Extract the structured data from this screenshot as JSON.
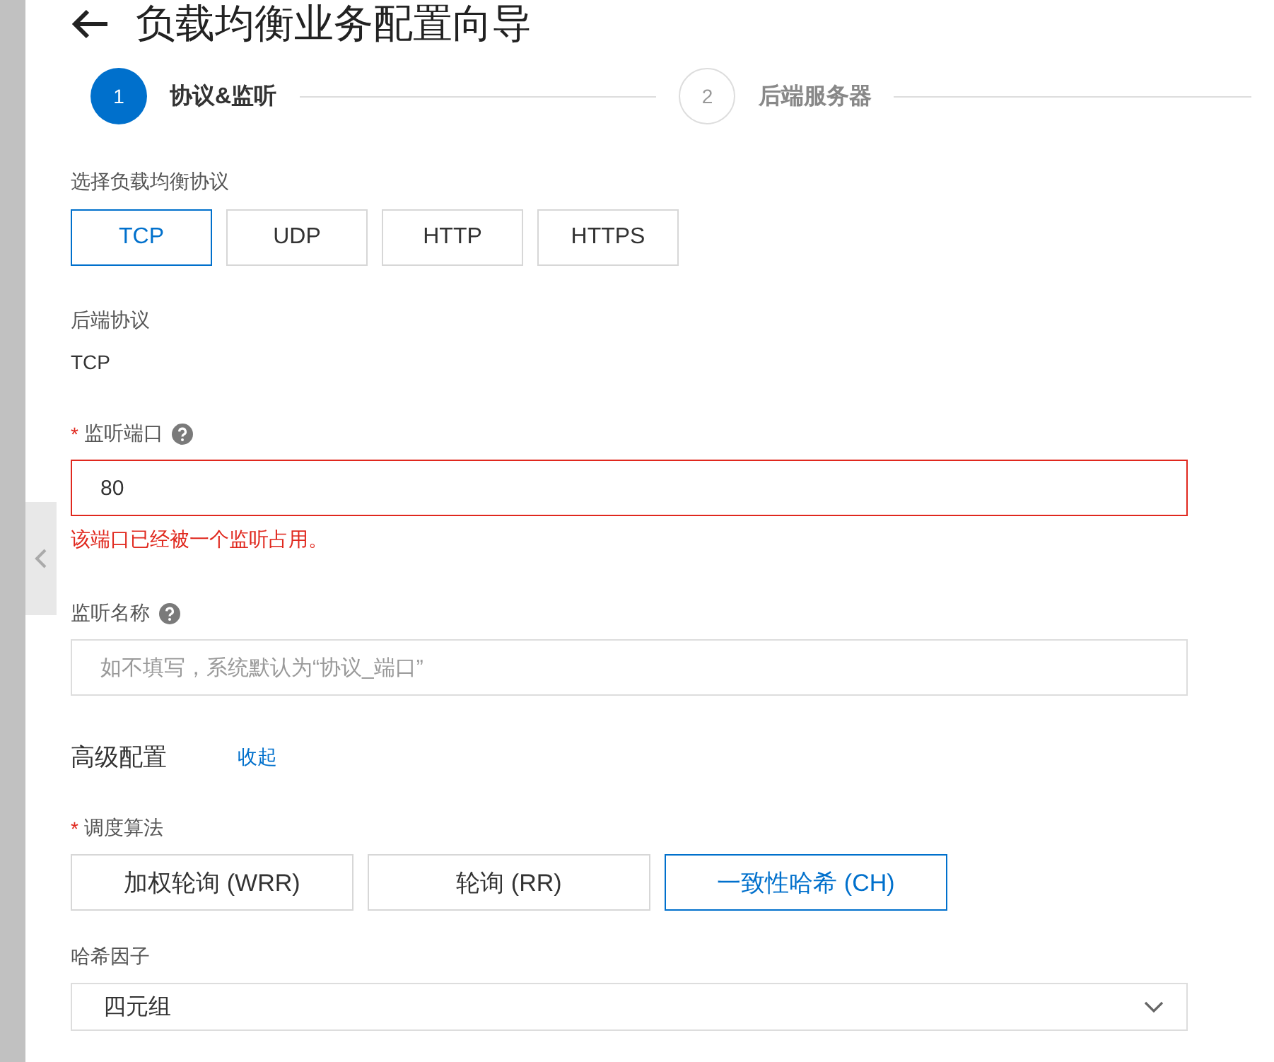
{
  "title": "负载均衡业务配置向导",
  "steps": [
    {
      "number": "1",
      "label": "协议&监听",
      "selected": true
    },
    {
      "number": "2",
      "label": "后端服务器",
      "selected": false
    }
  ],
  "protocol": {
    "label": "选择负载均衡协议",
    "options": [
      {
        "label": "TCP",
        "selected": true
      },
      {
        "label": "UDP",
        "selected": false
      },
      {
        "label": "HTTP",
        "selected": false
      },
      {
        "label": "HTTPS",
        "selected": false
      }
    ]
  },
  "backend_protocol": {
    "label": "后端协议",
    "value": "TCP"
  },
  "listen_port": {
    "label": "监听端口",
    "required_mark": "*",
    "value": "80",
    "error": "该端口已经被一个监听占用。"
  },
  "listen_name": {
    "label": "监听名称",
    "placeholder": "如不填写，系统默认为“协议_端口”"
  },
  "advanced": {
    "label": "高级配置",
    "toggle": "收起"
  },
  "scheduling": {
    "label": "调度算法",
    "required_mark": "*",
    "options": [
      {
        "label": "加权轮询 (WRR)",
        "selected": false
      },
      {
        "label": "轮询 (RR)",
        "selected": false
      },
      {
        "label": "一致性哈希 (CH)",
        "selected": true
      }
    ]
  },
  "hash_factor": {
    "label": "哈希因子",
    "value": "四元组"
  }
}
